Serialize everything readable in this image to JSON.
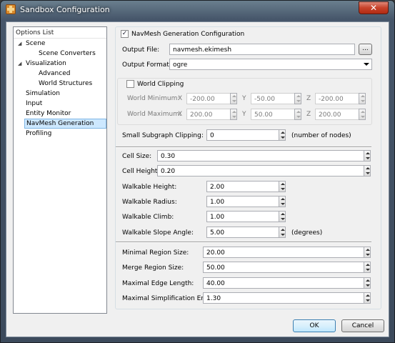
{
  "window": {
    "title": "Sandbox Configuration",
    "close_glyph": "✕",
    "icon": "sandbox-app-icon"
  },
  "nav": {
    "header": "Options List",
    "items": [
      {
        "label": "Scene"
      },
      {
        "label": "Scene Converters"
      },
      {
        "label": "Visualization"
      },
      {
        "label": "Advanced"
      },
      {
        "label": "World Structures"
      },
      {
        "label": "Simulation"
      },
      {
        "label": "Input"
      },
      {
        "label": "Entity Monitor"
      },
      {
        "label": "NavMesh Generation",
        "selected": true
      },
      {
        "label": "Profiling"
      }
    ]
  },
  "navmesh": {
    "section_title": "NavMesh Generation Configuration",
    "section_enabled": true,
    "output_file_label": "Output File:",
    "output_file_value": "navmesh.ekimesh",
    "browse_label": "...",
    "output_format_label": "Output Format:",
    "output_format_value": "ogre",
    "world_clipping": {
      "label": "World Clipping",
      "enabled": false,
      "min_label": "World Minimum:",
      "max_label": "World Maximum:",
      "x_label": "X",
      "y_label": "Y",
      "z_label": "Z",
      "min": {
        "x": "-200.00",
        "y": "-50.00",
        "z": "-200.00"
      },
      "max": {
        "x": "200.00",
        "y": "50.00",
        "z": "200.00"
      }
    },
    "small_subgraph_label": "Small Subgraph Clipping:",
    "small_subgraph_value": "0",
    "small_subgraph_unit": "(number of nodes)",
    "cell_size_label": "Cell Size:",
    "cell_size_value": "0.30",
    "cell_height_label": "Cell Height:",
    "cell_height_value": "0.20",
    "walkable_height_label": "Walkable Height:",
    "walkable_height_value": "2.00",
    "walkable_radius_label": "Walkable Radius:",
    "walkable_radius_value": "1.00",
    "walkable_climb_label": "Walkable Climb:",
    "walkable_climb_value": "1.00",
    "walkable_slope_label": "Walkable Slope Angle:",
    "walkable_slope_value": "5.00",
    "walkable_slope_unit": "(degrees)",
    "min_region_label": "Minimal Region Size:",
    "min_region_value": "20.00",
    "merge_region_label": "Merge Region Size:",
    "merge_region_value": "50.00",
    "max_edge_label": "Maximal Edge Length:",
    "max_edge_value": "40.00",
    "max_simpl_label": "Maximal Simplification Error:",
    "max_simpl_value": "1.30"
  },
  "buttons": {
    "ok": "OK",
    "cancel": "Cancel"
  },
  "colors": {
    "title_bar": "#46566a",
    "selection": "#cde8ff",
    "close_button": "#c7422a"
  }
}
